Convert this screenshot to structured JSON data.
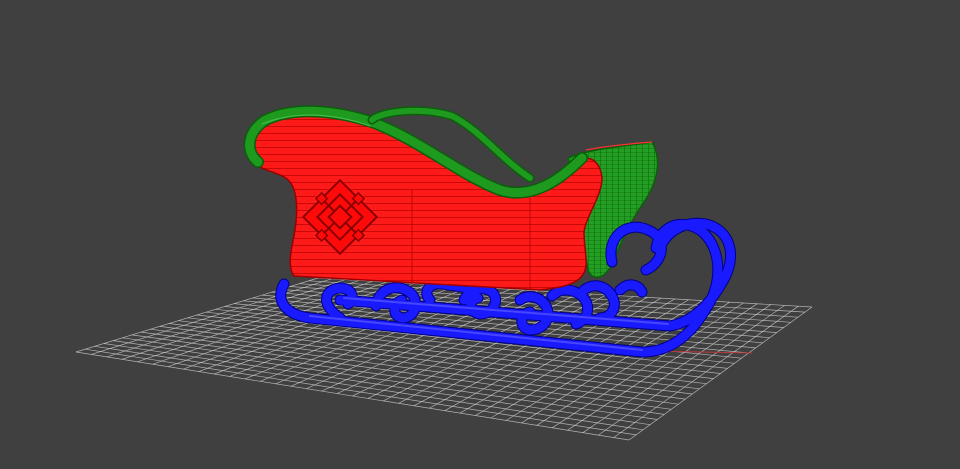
{
  "viewport": {
    "background": "#404040",
    "grid_color": "#cfcfcf",
    "axis_x_color": "#b83a3a",
    "grid": {
      "visible": true,
      "lines_u": 36,
      "lines_v": 26
    }
  },
  "model": {
    "object": "sleigh",
    "parts": [
      {
        "name": "body-side-panel",
        "color": "#ff1a1a",
        "wire_color": "#b30000"
      },
      {
        "name": "body-rim-trim",
        "color": "#1e9a1e",
        "wire_color": "#0c5e0c"
      },
      {
        "name": "back-seat-shell",
        "color": "#23a023",
        "wire_color": "#0e6a0e"
      },
      {
        "name": "runner-scrollwork",
        "color": "#1a1aff",
        "wire_color": "#00008a"
      },
      {
        "name": "ornament-emblem",
        "color": "#ff0a0a",
        "wire_color": "#8a0000"
      }
    ]
  }
}
